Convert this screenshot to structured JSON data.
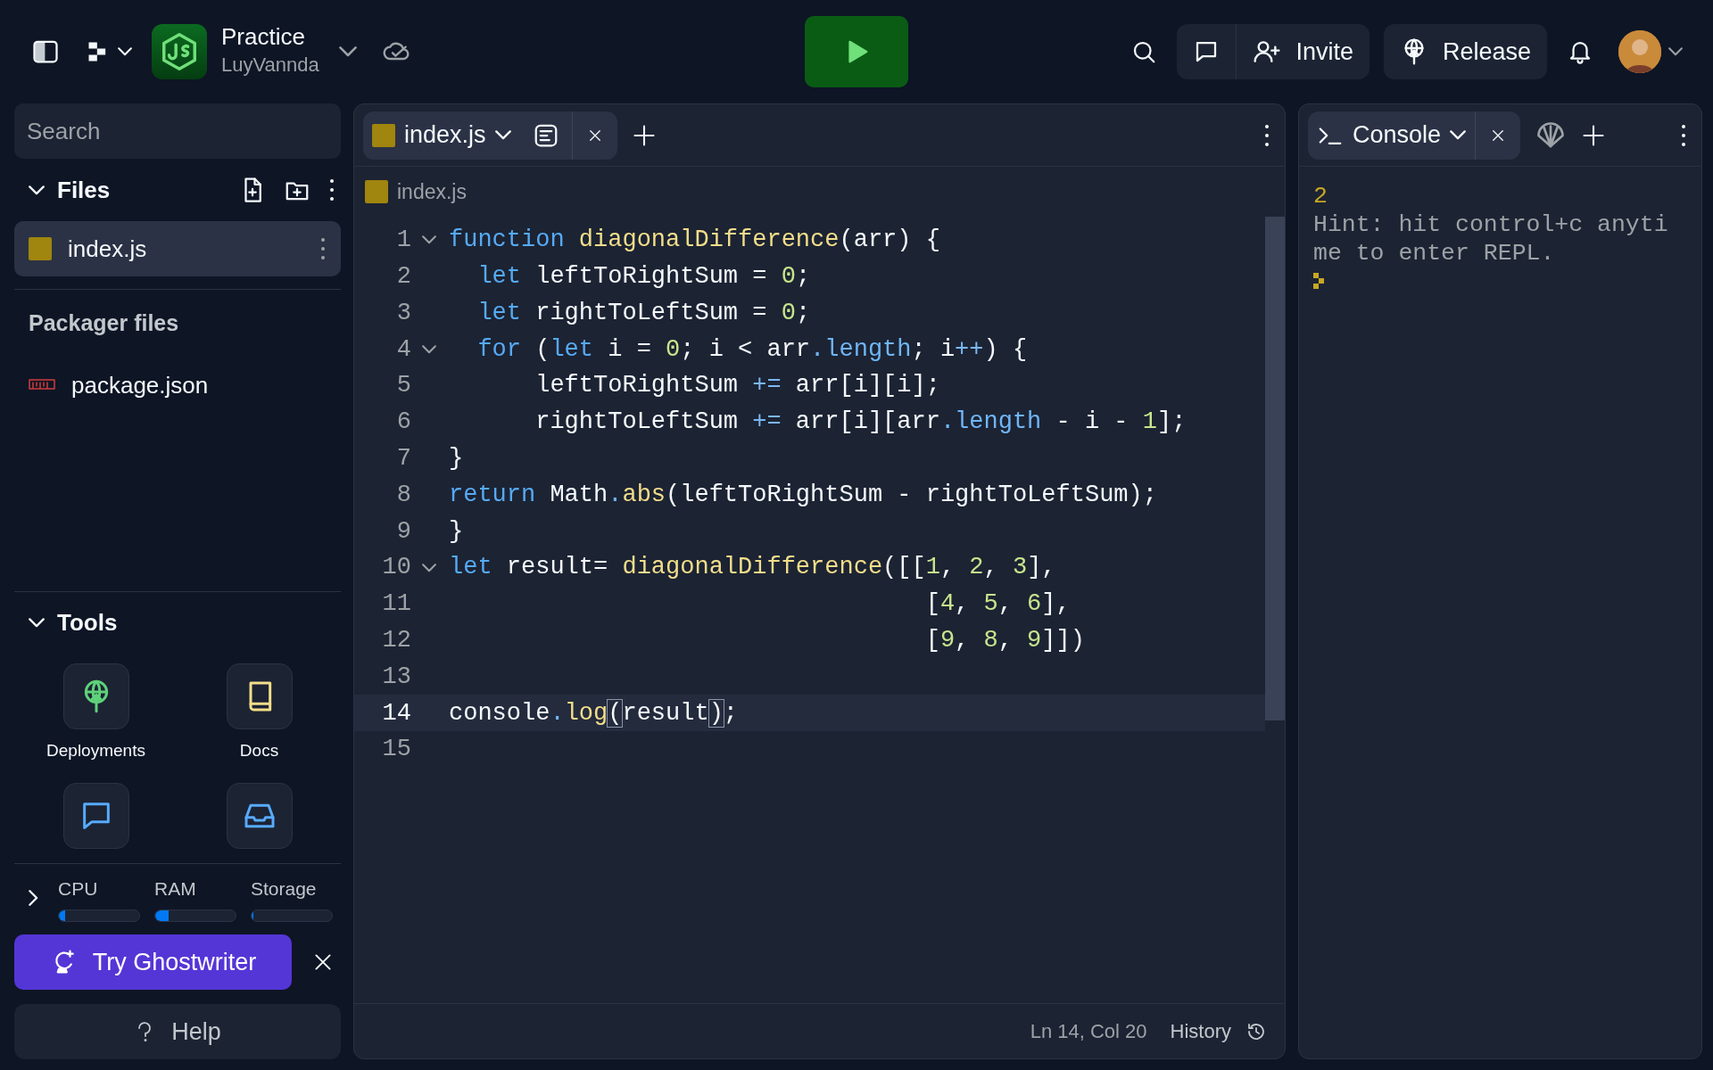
{
  "topbar": {
    "project_title": "Practice",
    "project_owner": "LuyVannda",
    "buttons": [
      {
        "kind": "invite",
        "label": "Invite"
      },
      {
        "kind": "release",
        "label": "Release"
      }
    ]
  },
  "sidebar": {
    "search": {
      "placeholder": "Search"
    },
    "files": {
      "title": "Files",
      "expanded": true,
      "items": [
        {
          "name": "index.js",
          "kind": "js",
          "selected": true
        }
      ]
    },
    "packager": {
      "title": "Packager files",
      "items": [
        {
          "name": "package.json",
          "kind": "npm",
          "selected": false
        }
      ]
    },
    "tools": {
      "title": "Tools",
      "expanded": true,
      "items": [
        {
          "kind": "deployments",
          "label": "Deployments"
        },
        {
          "kind": "docs",
          "label": "Docs"
        },
        {
          "kind": "chat"
        },
        {
          "kind": "threads"
        }
      ]
    },
    "resources": {
      "expanded": false,
      "meters": [
        {
          "label": "CPU",
          "level": 0.08
        },
        {
          "label": "RAM",
          "level": 0.17
        },
        {
          "label": "Storage",
          "level": 0.02
        }
      ]
    },
    "ghostwriter": {
      "label": "Try Ghostwriter"
    },
    "help": {
      "label": "Help"
    }
  },
  "editor": {
    "tabs": [
      {
        "label": "index.js",
        "selected": true
      }
    ],
    "breadcrumb": "index.js",
    "lines": [
      {
        "number": "1",
        "foldable": true,
        "current": false,
        "tokens": [
          {
            "kind": "keyword",
            "text": "function"
          },
          {
            "kind": "function",
            "text": " diagonalDifference"
          },
          {
            "kind": "text",
            "text": "(arr) {"
          }
        ]
      },
      {
        "number": "2",
        "foldable": false,
        "current": false,
        "tokens": [
          {
            "kind": "keyword",
            "text": "  let"
          },
          {
            "kind": "text",
            "text": " leftToRightSum = "
          },
          {
            "kind": "number",
            "text": "0"
          },
          {
            "kind": "text",
            "text": ";"
          }
        ]
      },
      {
        "number": "3",
        "foldable": false,
        "current": false,
        "tokens": [
          {
            "kind": "keyword",
            "text": "  let"
          },
          {
            "kind": "text",
            "text": " rightToLeftSum = "
          },
          {
            "kind": "number",
            "text": "0"
          },
          {
            "kind": "text",
            "text": ";"
          }
        ]
      },
      {
        "number": "4",
        "foldable": true,
        "current": false,
        "tokens": [
          {
            "kind": "keyword",
            "text": "  for"
          },
          {
            "kind": "text",
            "text": " ("
          },
          {
            "kind": "keyword",
            "text": "let"
          },
          {
            "kind": "text",
            "text": " i = "
          },
          {
            "kind": "number",
            "text": "0"
          },
          {
            "kind": "text",
            "text": "; i < arr"
          },
          {
            "kind": "property",
            "text": ".length"
          },
          {
            "kind": "text",
            "text": "; i"
          },
          {
            "kind": "operator",
            "text": "++"
          },
          {
            "kind": "text",
            "text": ") {"
          }
        ]
      },
      {
        "number": "5",
        "foldable": false,
        "current": false,
        "tokens": [
          {
            "kind": "text",
            "text": "      leftToRightSum "
          },
          {
            "kind": "operator",
            "text": "+="
          },
          {
            "kind": "text",
            "text": " arr[i][i];"
          }
        ]
      },
      {
        "number": "6",
        "foldable": false,
        "current": false,
        "tokens": [
          {
            "kind": "text",
            "text": "      rightToLeftSum "
          },
          {
            "kind": "operator",
            "text": "+="
          },
          {
            "kind": "text",
            "text": " arr[i][arr"
          },
          {
            "kind": "property",
            "text": ".length"
          },
          {
            "kind": "text",
            "text": " - i - "
          },
          {
            "kind": "number",
            "text": "1"
          },
          {
            "kind": "text",
            "text": "];"
          }
        ]
      },
      {
        "number": "7",
        "foldable": false,
        "current": false,
        "tokens": [
          {
            "kind": "text",
            "text": "}"
          }
        ]
      },
      {
        "number": "8",
        "foldable": false,
        "current": false,
        "tokens": [
          {
            "kind": "keyword",
            "text": "return"
          },
          {
            "kind": "text",
            "text": " Math"
          },
          {
            "kind": "property",
            "text": "."
          },
          {
            "kind": "function",
            "text": "abs"
          },
          {
            "kind": "text",
            "text": "(leftToRightSum - rightToLeftSum);"
          }
        ]
      },
      {
        "number": "9",
        "foldable": false,
        "current": false,
        "tokens": [
          {
            "kind": "text",
            "text": "}"
          }
        ]
      },
      {
        "number": "10",
        "foldable": true,
        "current": false,
        "tokens": [
          {
            "kind": "keyword",
            "text": "let"
          },
          {
            "kind": "text",
            "text": " result= "
          },
          {
            "kind": "function",
            "text": "diagonalDifference"
          },
          {
            "kind": "text",
            "text": "([["
          },
          {
            "kind": "number",
            "text": "1"
          },
          {
            "kind": "text",
            "text": ", "
          },
          {
            "kind": "number",
            "text": "2"
          },
          {
            "kind": "text",
            "text": ", "
          },
          {
            "kind": "number",
            "text": "3"
          },
          {
            "kind": "text",
            "text": "],"
          }
        ]
      },
      {
        "number": "11",
        "foldable": false,
        "current": false,
        "tokens": [
          {
            "kind": "text",
            "text": "                                 ["
          },
          {
            "kind": "number",
            "text": "4"
          },
          {
            "kind": "text",
            "text": ", "
          },
          {
            "kind": "number",
            "text": "5"
          },
          {
            "kind": "text",
            "text": ", "
          },
          {
            "kind": "number",
            "text": "6"
          },
          {
            "kind": "text",
            "text": "],"
          }
        ]
      },
      {
        "number": "12",
        "foldable": false,
        "current": false,
        "tokens": [
          {
            "kind": "text",
            "text": "                                 ["
          },
          {
            "kind": "number",
            "text": "9"
          },
          {
            "kind": "text",
            "text": ", "
          },
          {
            "kind": "number",
            "text": "8"
          },
          {
            "kind": "text",
            "text": ", "
          },
          {
            "kind": "number",
            "text": "9"
          },
          {
            "kind": "text",
            "text": "]])"
          }
        ]
      },
      {
        "number": "13",
        "foldable": false,
        "current": false
      },
      {
        "number": "14",
        "foldable": false,
        "current": true,
        "tokens": [
          {
            "kind": "text",
            "text": "console"
          },
          {
            "kind": "property",
            "text": "."
          },
          {
            "kind": "function",
            "text": "log"
          },
          {
            "kind": "bracket",
            "text": "("
          },
          {
            "kind": "text",
            "text": "result"
          },
          {
            "kind": "bracket",
            "text": ")"
          },
          {
            "kind": "text",
            "text": ";"
          }
        ]
      },
      {
        "number": "15",
        "foldable": false,
        "current": false
      }
    ],
    "status": {
      "position": "Ln 14, Col 20",
      "history": "History"
    }
  },
  "console": {
    "tabs": [
      {
        "label": "Console",
        "selected": true
      }
    ],
    "output": [
      {
        "kind": "result",
        "text": "2"
      },
      {
        "kind": "hint",
        "text": "Hint: hit control+c anytime to enter REPL."
      }
    ]
  }
}
